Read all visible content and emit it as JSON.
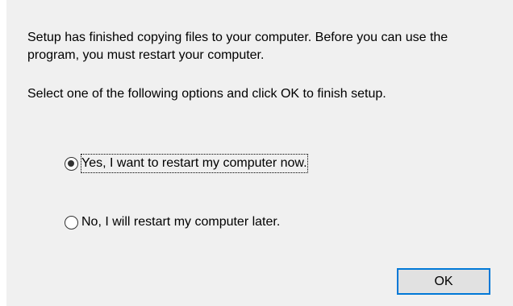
{
  "dialog": {
    "message": "Setup has finished copying files to your computer.  Before you can use the program, you must restart your computer.",
    "instruction": "Select one of the following options and click OK to finish setup.",
    "options": [
      {
        "label": "Yes, I want to restart my computer now.",
        "checked": true
      },
      {
        "label": "No, I will restart my computer later.",
        "checked": false
      }
    ],
    "ok_label": "OK"
  },
  "colors": {
    "background": "#f0f0f0",
    "button_border_accent": "#0078d7",
    "button_face": "#e1e1e1"
  }
}
